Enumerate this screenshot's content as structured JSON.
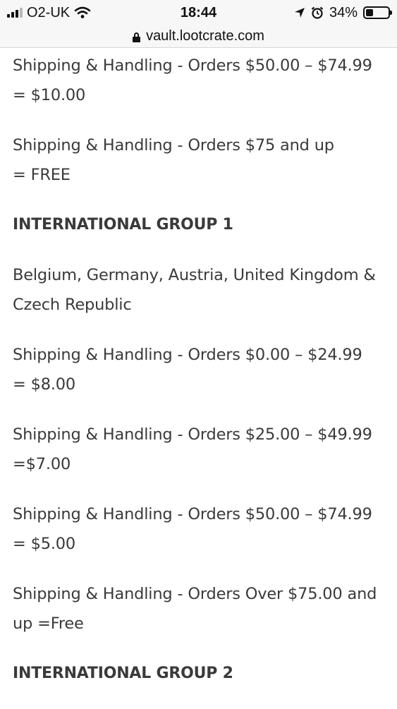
{
  "status_bar": {
    "carrier": "O2-UK",
    "time": "18:44",
    "battery_text": "34%",
    "battery_level": 0.34,
    "icons": [
      "signal-icon",
      "wifi-icon",
      "location-arrow-icon",
      "alarm-icon",
      "battery-icon"
    ]
  },
  "url_bar": {
    "domain": "vault.lootcrate.com",
    "icon": "lock-icon"
  },
  "content": {
    "shipping_50_74": [
      "Shipping & Handling - Orders $50.00 – $74.99",
      " = $10.00"
    ],
    "shipping_75_up": [
      "Shipping & Handling - Orders $75 and up",
      " = FREE"
    ],
    "intl_group_1": "INTERNATIONAL GROUP 1",
    "intl_group_1_countries": [
      "Belgium, Germany, Austria, United Kingdom &",
      "Czech Republic"
    ],
    "intl1_0_24": [
      "Shipping & Handling - Orders $0.00 – $24.99",
      "= $8.00"
    ],
    "intl1_25_49": [
      "Shipping & Handling - Orders $25.00 – $49.99",
      "=$7.00"
    ],
    "intl1_50_74": [
      "Shipping & Handling - Orders $50.00 – $74.99",
      "= $5.00"
    ],
    "intl1_75_up": [
      "Shipping & Handling - Orders Over $75.00 and",
      "up =Free"
    ],
    "intl_group_2": "INTERNATIONAL GROUP 2"
  }
}
